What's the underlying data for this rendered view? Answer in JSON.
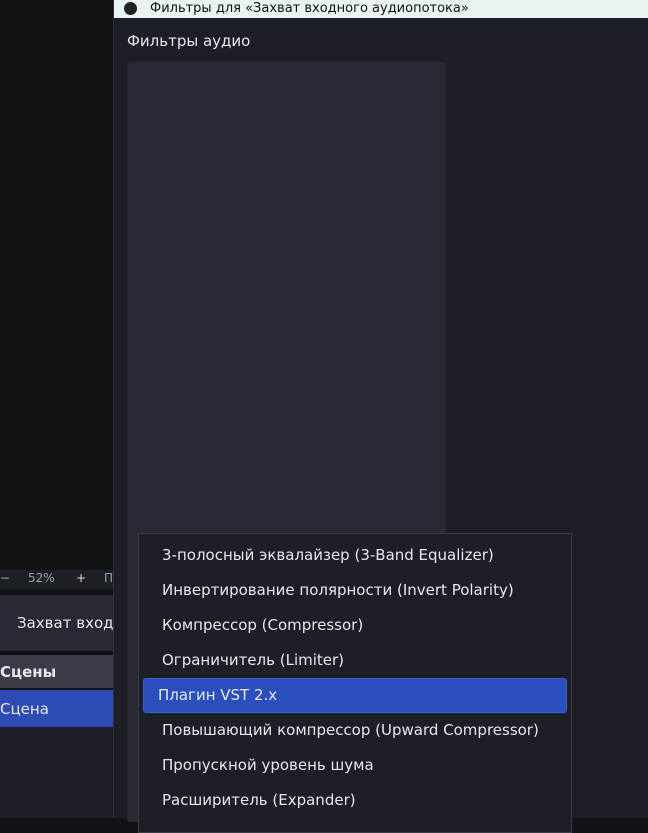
{
  "main_window": {
    "zoom": {
      "minus": "−",
      "value": "52%",
      "plus": "+",
      "next": "П"
    },
    "source": {
      "icon": "microphone-icon",
      "label": "Захват входного аудиопотока"
    },
    "scenes": {
      "header": "Сцены",
      "items": [
        {
          "label": "Сцена",
          "selected": true
        }
      ]
    }
  },
  "dialog": {
    "title": "Фильтры для «Захват входного аудиопотока»",
    "audio_filters_label": "Фильтры аудио"
  },
  "menu": {
    "items": [
      {
        "label": "3-полосный эквалайзер (3-Band Equalizer)"
      },
      {
        "label": "Инвертирование полярности (Invert Polarity)"
      },
      {
        "label": "Компрессор (Compressor)"
      },
      {
        "label": "Ограничитель (Limiter)"
      },
      {
        "label": "Плагин VST 2.x",
        "highlighted": true
      },
      {
        "label": "Повышающий компрессор (Upward Compressor)"
      },
      {
        "label": "Пропускной уровень шума"
      },
      {
        "label": "Расширитель (Expander)"
      }
    ]
  },
  "colors": {
    "accent": "#2a4fbd",
    "panel": "#272a33",
    "bg": "#1d1f26"
  }
}
